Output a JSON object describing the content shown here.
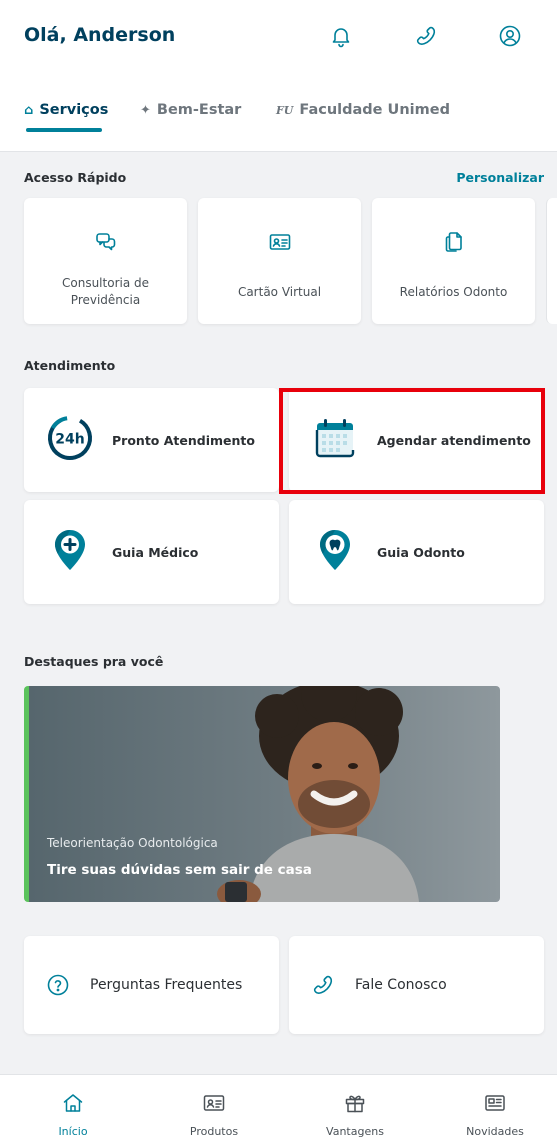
{
  "header": {
    "greeting": "Olá, Anderson",
    "icons": [
      "bell-icon",
      "phone-icon",
      "user-circle-icon"
    ]
  },
  "tabs": [
    {
      "label": "Serviços",
      "glyph": "⌂",
      "active": true
    },
    {
      "label": "Bem-Estar",
      "glyph": "✦",
      "active": false
    },
    {
      "label": "Faculdade Unimed",
      "glyph": "FU",
      "active": false
    }
  ],
  "quick_access": {
    "title": "Acesso Rápido",
    "customize_label": "Personalizar",
    "items": [
      {
        "label": "Consultoria de Previdência",
        "icon": "chat-bubbles-icon"
      },
      {
        "label": "Cartão Virtual",
        "icon": "id-card-icon"
      },
      {
        "label": "Relatórios Odonto",
        "icon": "documents-icon"
      }
    ]
  },
  "service": {
    "title": "Atendimento",
    "items": [
      {
        "label": "Pronto Atendimento",
        "icon": "24h-icon",
        "badge": "24h"
      },
      {
        "label": "Agendar atendimento",
        "icon": "calendar-icon"
      },
      {
        "label": "Guia Médico",
        "icon": "medical-pin-icon"
      },
      {
        "label": "Guia Odonto",
        "icon": "tooth-pin-icon"
      }
    ]
  },
  "highlights": {
    "title": "Destaques pra você",
    "banner": {
      "subtitle": "Teleorientação Odontológica",
      "title": "Tire suas dúvidas sem sair de casa"
    }
  },
  "footer_links": [
    {
      "label": "Perguntas Frequentes",
      "icon": "question-circle-icon"
    },
    {
      "label": "Fale Conosco",
      "icon": "phone-icon"
    }
  ],
  "bottom_nav": [
    {
      "label": "Início",
      "icon": "home-icon",
      "active": true
    },
    {
      "label": "Produtos",
      "icon": "id-card-icon",
      "active": false
    },
    {
      "label": "Vantagens",
      "icon": "gift-icon",
      "active": false
    },
    {
      "label": "Novidades",
      "icon": "newspaper-icon",
      "active": false
    }
  ],
  "colors": {
    "brand_dark": "#00405e",
    "brand_teal": "#00809a",
    "accent_green": "#5bc35c",
    "highlight_red": "#e8000b"
  }
}
